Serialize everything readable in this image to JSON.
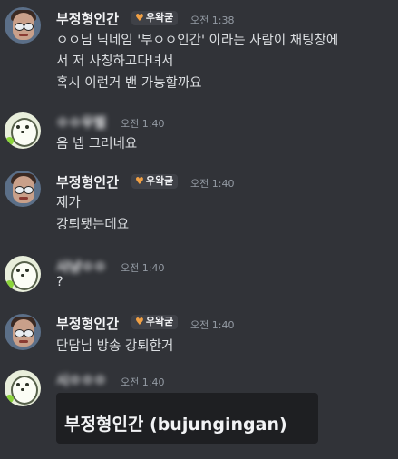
{
  "messages": [
    {
      "author": "부정형인간",
      "badge": "우왁굳",
      "time": "오전 1:38",
      "lines": [
        "ㅇㅇ님 닉네임 '부ㅇㅇ인간' 이라는 사람이 채팅창에",
        "서 저 사칭하고다녀서",
        "혹시 이런거 밴 가능할까요"
      ]
    },
    {
      "author": "ㅇㅇ우벌",
      "time": "오전 1:40",
      "lines": [
        "음 넵 그러네요"
      ]
    },
    {
      "author": "부정형인간",
      "badge": "우왁굳",
      "time": "오전 1:40",
      "lines": [
        "제가",
        "강퇴됏는데요"
      ]
    },
    {
      "author": "사냥ㅇㅇ",
      "time": "오전 1:40",
      "lines": [
        "?"
      ]
    },
    {
      "author": "부정형인간",
      "badge": "우왁굳",
      "time": "오전 1:40",
      "lines": [
        "단답님 방송 강퇴한거"
      ]
    },
    {
      "author": "시ㅇㅇㅇ",
      "time": "오전 1:40",
      "embed": "부정형인간 (bujungingan)"
    }
  ]
}
